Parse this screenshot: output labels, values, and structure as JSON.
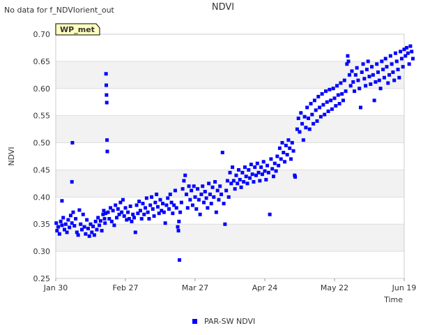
{
  "notice": "No data for f_NDVIorient_out",
  "site_badge": "WP_met",
  "colors": {
    "series": "#0000ff",
    "badge_fill": "#ffffc0",
    "badge_text": "#8b0000",
    "band": "#f2f2f2",
    "grid": "#dddddd"
  },
  "chart_data": {
    "type": "scatter",
    "title": "NDVI",
    "xlabel": "Time",
    "ylabel": "NDVI",
    "ylim": [
      0.25,
      0.7
    ],
    "xlim": [
      "Jan 30",
      "Jun 19"
    ],
    "x_ticks": [
      "Jan 30",
      "Feb 27",
      "Mar 27",
      "Apr 24",
      "May 22",
      "Jun 19"
    ],
    "y_ticks": [
      "0.25",
      "0.30",
      "0.35",
      "0.40",
      "0.45",
      "0.50",
      "0.55",
      "0.60",
      "0.65",
      "0.70"
    ],
    "grid": true,
    "legend": "bottom-center",
    "series": [
      {
        "name": "PAR-SW NDVI",
        "marker": "square",
        "points_day_ndvi": [
          [
            0.2,
            0.352
          ],
          [
            0.5,
            0.338
          ],
          [
            1,
            0.345
          ],
          [
            1.5,
            0.332
          ],
          [
            2,
            0.355
          ],
          [
            2.5,
            0.348
          ],
          [
            3,
            0.362
          ],
          [
            3.5,
            0.34
          ],
          [
            4,
            0.35
          ],
          [
            4.5,
            0.335
          ],
          [
            5,
            0.358
          ],
          [
            5.5,
            0.344
          ],
          [
            6,
            0.366
          ],
          [
            6.5,
            0.352
          ],
          [
            7,
            0.372
          ],
          [
            7.5,
            0.347
          ],
          [
            8,
            0.36
          ],
          [
            8.5,
            0.335
          ],
          [
            9,
            0.33
          ],
          [
            2.5,
            0.393
          ],
          [
            6.5,
            0.428
          ],
          [
            6.7,
            0.5
          ],
          [
            9.5,
            0.376
          ],
          [
            10,
            0.35
          ],
          [
            10.5,
            0.34
          ],
          [
            11,
            0.368
          ],
          [
            11.5,
            0.345
          ],
          [
            12,
            0.332
          ],
          [
            12.5,
            0.358
          ],
          [
            13,
            0.342
          ],
          [
            13.5,
            0.328
          ],
          [
            14,
            0.35
          ],
          [
            14.5,
            0.335
          ],
          [
            15,
            0.346
          ],
          [
            15.5,
            0.33
          ],
          [
            16,
            0.355
          ],
          [
            16.5,
            0.34
          ],
          [
            17,
            0.362
          ],
          [
            17.5,
            0.348
          ],
          [
            18,
            0.356
          ],
          [
            18.5,
            0.338
          ],
          [
            19,
            0.368
          ],
          [
            19.3,
            0.375
          ],
          [
            19.6,
            0.36
          ],
          [
            19.8,
            0.352
          ],
          [
            20,
            0.37
          ],
          [
            20.2,
            0.627
          ],
          [
            20.3,
            0.606
          ],
          [
            20.4,
            0.588
          ],
          [
            20.5,
            0.574
          ],
          [
            20.6,
            0.505
          ],
          [
            20.7,
            0.484
          ],
          [
            21,
            0.372
          ],
          [
            21.5,
            0.36
          ],
          [
            22,
            0.38
          ],
          [
            22.5,
            0.355
          ],
          [
            23,
            0.375
          ],
          [
            23.5,
            0.348
          ],
          [
            24,
            0.385
          ],
          [
            24.5,
            0.362
          ],
          [
            25,
            0.378
          ],
          [
            25.5,
            0.368
          ],
          [
            26,
            0.39
          ],
          [
            26.5,
            0.372
          ],
          [
            27,
            0.395
          ],
          [
            27.5,
            0.365
          ],
          [
            28,
            0.38
          ],
          [
            28.5,
            0.358
          ],
          [
            29,
            0.372
          ],
          [
            29.5,
            0.36
          ],
          [
            30,
            0.383
          ],
          [
            30.5,
            0.355
          ],
          [
            31,
            0.368
          ],
          [
            31.5,
            0.362
          ],
          [
            32,
            0.335
          ],
          [
            32.5,
            0.385
          ],
          [
            33,
            0.37
          ],
          [
            33.5,
            0.392
          ],
          [
            34,
            0.375
          ],
          [
            34.5,
            0.36
          ],
          [
            35,
            0.388
          ],
          [
            35.5,
            0.368
          ],
          [
            36,
            0.38
          ],
          [
            36.5,
            0.398
          ],
          [
            37,
            0.372
          ],
          [
            37.5,
            0.36
          ],
          [
            38,
            0.385
          ],
          [
            38.5,
            0.4
          ],
          [
            39,
            0.378
          ],
          [
            39.5,
            0.365
          ],
          [
            40,
            0.39
          ],
          [
            40.5,
            0.405
          ],
          [
            41,
            0.382
          ],
          [
            41.5,
            0.37
          ],
          [
            42,
            0.395
          ],
          [
            42.5,
            0.375
          ],
          [
            43,
            0.388
          ],
          [
            43.5,
            0.372
          ],
          [
            44,
            0.352
          ],
          [
            44.5,
            0.385
          ],
          [
            45,
            0.398
          ],
          [
            45.5,
            0.378
          ],
          [
            46,
            0.405
          ],
          [
            46.5,
            0.39
          ],
          [
            47,
            0.37
          ],
          [
            47.5,
            0.385
          ],
          [
            48,
            0.412
          ],
          [
            48.5,
            0.38
          ],
          [
            49,
            0.345
          ],
          [
            49.3,
            0.338
          ],
          [
            49.5,
            0.355
          ],
          [
            49.7,
            0.284
          ],
          [
            50,
            0.372
          ],
          [
            50.5,
            0.39
          ],
          [
            51,
            0.415
          ],
          [
            51.5,
            0.43
          ],
          [
            52,
            0.44
          ],
          [
            52.5,
            0.405
          ],
          [
            53,
            0.38
          ],
          [
            53.5,
            0.42
          ],
          [
            54,
            0.395
          ],
          [
            54.5,
            0.412
          ],
          [
            55,
            0.385
          ],
          [
            55.5,
            0.42
          ],
          [
            56,
            0.4
          ],
          [
            56.5,
            0.378
          ],
          [
            57,
            0.415
          ],
          [
            57.5,
            0.395
          ],
          [
            58,
            0.368
          ],
          [
            58.5,
            0.405
          ],
          [
            59,
            0.42
          ],
          [
            59.5,
            0.39
          ],
          [
            60,
            0.41
          ],
          [
            60.5,
            0.398
          ],
          [
            61,
            0.38
          ],
          [
            61.5,
            0.425
          ],
          [
            62,
            0.405
          ],
          [
            62.5,
            0.388
          ],
          [
            63,
            0.418
          ],
          [
            63.5,
            0.4
          ],
          [
            64,
            0.428
          ],
          [
            64.5,
            0.372
          ],
          [
            65,
            0.412
          ],
          [
            65.5,
            0.395
          ],
          [
            66,
            0.42
          ],
          [
            66.5,
            0.405
          ],
          [
            67,
            0.482
          ],
          [
            67.5,
            0.388
          ],
          [
            68,
            0.35
          ],
          [
            68.5,
            0.412
          ],
          [
            69,
            0.43
          ],
          [
            69.5,
            0.4
          ],
          [
            70,
            0.445
          ],
          [
            70.5,
            0.425
          ],
          [
            71,
            0.455
          ],
          [
            71.5,
            0.43
          ],
          [
            72,
            0.415
          ],
          [
            72.5,
            0.44
          ],
          [
            73,
            0.425
          ],
          [
            73.5,
            0.45
          ],
          [
            74,
            0.432
          ],
          [
            74.5,
            0.418
          ],
          [
            75,
            0.445
          ],
          [
            75.5,
            0.428
          ],
          [
            76,
            0.455
          ],
          [
            76.5,
            0.438
          ],
          [
            77,
            0.425
          ],
          [
            77.5,
            0.45
          ],
          [
            78,
            0.435
          ],
          [
            78.5,
            0.46
          ],
          [
            79,
            0.442
          ],
          [
            79.5,
            0.428
          ],
          [
            80,
            0.455
          ],
          [
            80.5,
            0.44
          ],
          [
            81,
            0.462
          ],
          [
            81.5,
            0.445
          ],
          [
            82,
            0.43
          ],
          [
            82.5,
            0.455
          ],
          [
            83,
            0.442
          ],
          [
            83.5,
            0.465
          ],
          [
            84,
            0.448
          ],
          [
            84.5,
            0.432
          ],
          [
            85,
            0.458
          ],
          [
            85.5,
            0.445
          ],
          [
            86,
            0.368
          ],
          [
            86.5,
            0.47
          ],
          [
            87,
            0.452
          ],
          [
            87.5,
            0.438
          ],
          [
            88,
            0.462
          ],
          [
            88.5,
            0.448
          ],
          [
            89,
            0.475
          ],
          [
            89.5,
            0.458
          ],
          [
            90,
            0.49
          ],
          [
            90.5,
            0.47
          ],
          [
            91,
            0.5
          ],
          [
            91.5,
            0.482
          ],
          [
            92,
            0.465
          ],
          [
            92.5,
            0.495
          ],
          [
            93,
            0.478
          ],
          [
            93.5,
            0.505
          ],
          [
            94,
            0.49
          ],
          [
            94.5,
            0.47
          ],
          [
            95,
            0.5
          ],
          [
            95.5,
            0.485
          ],
          [
            96,
            0.44
          ],
          [
            96.2,
            0.437
          ],
          [
            97,
            0.525
          ],
          [
            97.5,
            0.545
          ],
          [
            98,
            0.52
          ],
          [
            98.5,
            0.555
          ],
          [
            99,
            0.535
          ],
          [
            99.5,
            0.505
          ],
          [
            100,
            0.548
          ],
          [
            100.5,
            0.528
          ],
          [
            101,
            0.565
          ],
          [
            101.5,
            0.545
          ],
          [
            102,
            0.525
          ],
          [
            102.5,
            0.572
          ],
          [
            103,
            0.552
          ],
          [
            103.5,
            0.535
          ],
          [
            104,
            0.578
          ],
          [
            104.5,
            0.56
          ],
          [
            105,
            0.54
          ],
          [
            105.5,
            0.585
          ],
          [
            106,
            0.565
          ],
          [
            106.5,
            0.548
          ],
          [
            107,
            0.59
          ],
          [
            107.5,
            0.57
          ],
          [
            108,
            0.552
          ],
          [
            108.5,
            0.595
          ],
          [
            109,
            0.575
          ],
          [
            109.5,
            0.558
          ],
          [
            110,
            0.598
          ],
          [
            110.5,
            0.578
          ],
          [
            111,
            0.562
          ],
          [
            111.5,
            0.6
          ],
          [
            112,
            0.582
          ],
          [
            112.5,
            0.568
          ],
          [
            113,
            0.605
          ],
          [
            113.5,
            0.588
          ],
          [
            114,
            0.572
          ],
          [
            114.5,
            0.61
          ],
          [
            115,
            0.59
          ],
          [
            115.5,
            0.578
          ],
          [
            116,
            0.615
          ],
          [
            116.5,
            0.595
          ],
          [
            117,
            0.645
          ],
          [
            117.3,
            0.66
          ],
          [
            117.6,
            0.65
          ],
          [
            118,
            0.625
          ],
          [
            118.5,
            0.605
          ],
          [
            119,
            0.632
          ],
          [
            119.5,
            0.612
          ],
          [
            120,
            0.595
          ],
          [
            120.5,
            0.625
          ],
          [
            121,
            0.638
          ],
          [
            121.5,
            0.615
          ],
          [
            122,
            0.6
          ],
          [
            122.5,
            0.565
          ],
          [
            123,
            0.63
          ],
          [
            123.5,
            0.645
          ],
          [
            124,
            0.618
          ],
          [
            124.5,
            0.605
          ],
          [
            125,
            0.635
          ],
          [
            125.5,
            0.65
          ],
          [
            126,
            0.622
          ],
          [
            126.5,
            0.608
          ],
          [
            127,
            0.64
          ],
          [
            127.5,
            0.625
          ],
          [
            128,
            0.578
          ],
          [
            128.5,
            0.612
          ],
          [
            129,
            0.645
          ],
          [
            129.5,
            0.63
          ],
          [
            130,
            0.615
          ],
          [
            130.5,
            0.6
          ],
          [
            131,
            0.65
          ],
          [
            131.5,
            0.635
          ],
          [
            132,
            0.62
          ],
          [
            132.5,
            0.655
          ],
          [
            133,
            0.64
          ],
          [
            133.5,
            0.61
          ],
          [
            134,
            0.625
          ],
          [
            134.5,
            0.66
          ],
          [
            135,
            0.645
          ],
          [
            135.5,
            0.63
          ],
          [
            136,
            0.615
          ],
          [
            136.5,
            0.665
          ],
          [
            137,
            0.65
          ],
          [
            137.5,
            0.635
          ],
          [
            138,
            0.62
          ],
          [
            138.5,
            0.668
          ],
          [
            139,
            0.655
          ],
          [
            139.5,
            0.64
          ],
          [
            140,
            0.672
          ],
          [
            140.5,
            0.66
          ],
          [
            141,
            0.675
          ],
          [
            141.5,
            0.665
          ],
          [
            142,
            0.645
          ],
          [
            142.5,
            0.678
          ],
          [
            143,
            0.668
          ],
          [
            143.5,
            0.655
          ]
        ]
      }
    ]
  }
}
